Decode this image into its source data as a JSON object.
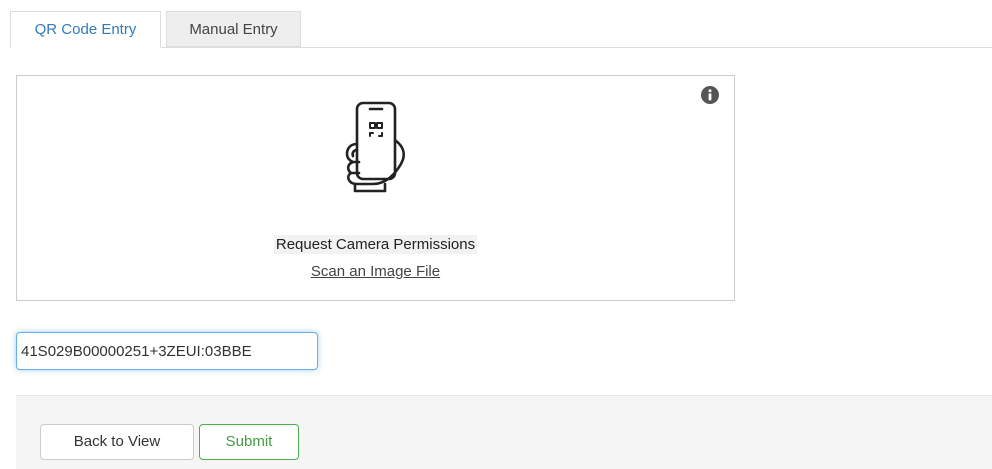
{
  "tabs": {
    "active_label": "QR Code Entry",
    "inactive_label": "Manual Entry"
  },
  "scanner": {
    "info_icon": "info-circle-icon",
    "phone_icon": "phone-qr-scan-icon",
    "permission_label": "Request Camera Permissions",
    "scan_file_link": "Scan an Image File"
  },
  "code_input": {
    "value": "41S029B00000251+3ZEUI:03BBE"
  },
  "footer": {
    "back_label": "Back to View",
    "submit_label": "Submit"
  },
  "colors": {
    "tab_active_text": "#337ab7",
    "input_focus_border": "#66afe9",
    "submit_accent": "#4cae4c"
  }
}
